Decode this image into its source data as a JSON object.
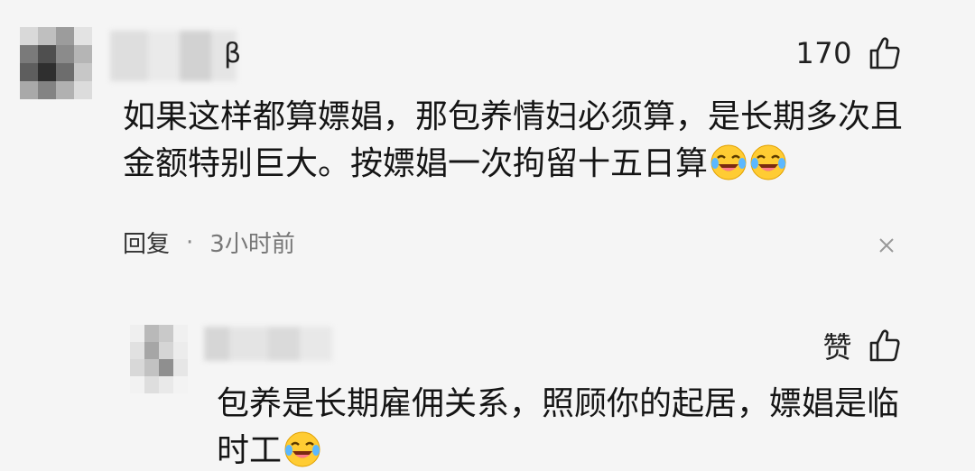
{
  "comment": {
    "name_tail": "β",
    "like_count": "170",
    "text": "如果这样都算嫖娼，那包养情妇必须算，是长期多次且金额特别巨大。按嫖娼一次拘留十五日算",
    "emojis": [
      "laughing-crying-emoji",
      "laughing-crying-emoji"
    ],
    "reply_label": "回复",
    "separator": "·",
    "time": "3小时前"
  },
  "reply": {
    "like_label": "赞",
    "text": "包养是长期雇佣关系，照顾你的起居，嫖娼是临时工",
    "emojis": [
      "laughing-crying-emoji"
    ]
  },
  "colors": {
    "background": "#f5f5f5",
    "text": "#151515",
    "meta": "#777777",
    "emoji_face": "#ffcc33"
  }
}
